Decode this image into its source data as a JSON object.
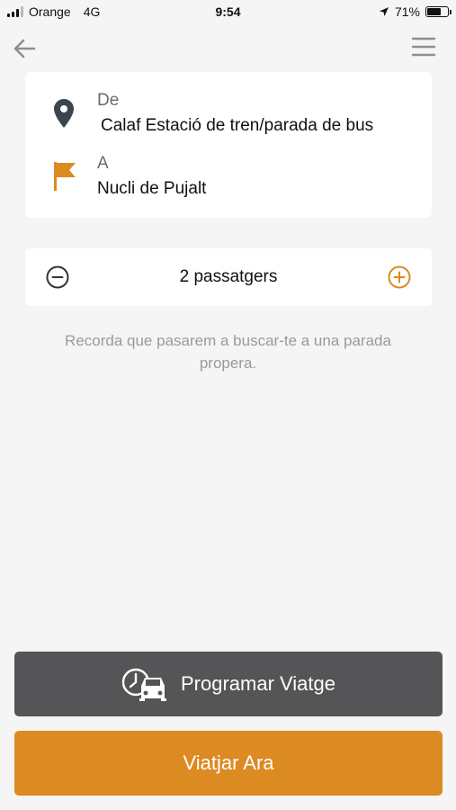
{
  "status_bar": {
    "carrier": "Orange",
    "network": "4G",
    "time": "9:54",
    "battery_text": "71%",
    "battery_level": 0.71
  },
  "nav": {
    "back_icon": "arrow-left-icon",
    "menu_icon": "hamburger-menu-icon"
  },
  "route": {
    "from_label": "De",
    "from_value": "Calaf Estació de tren/parada de bus",
    "to_label": "A",
    "to_value": "Nucli de Pujalt",
    "from_icon": "location-pin-icon",
    "to_icon": "flag-icon"
  },
  "passengers": {
    "label": "2 passatgers"
  },
  "hint": "Recorda que pasarem a buscar-te a una parada propera.",
  "actions": {
    "schedule_label": "Programar Viatge",
    "now_label": "Viatjar Ara"
  },
  "colors": {
    "accent": "#dc8a22",
    "dark_button": "#555557",
    "pin": "#3b4552"
  }
}
